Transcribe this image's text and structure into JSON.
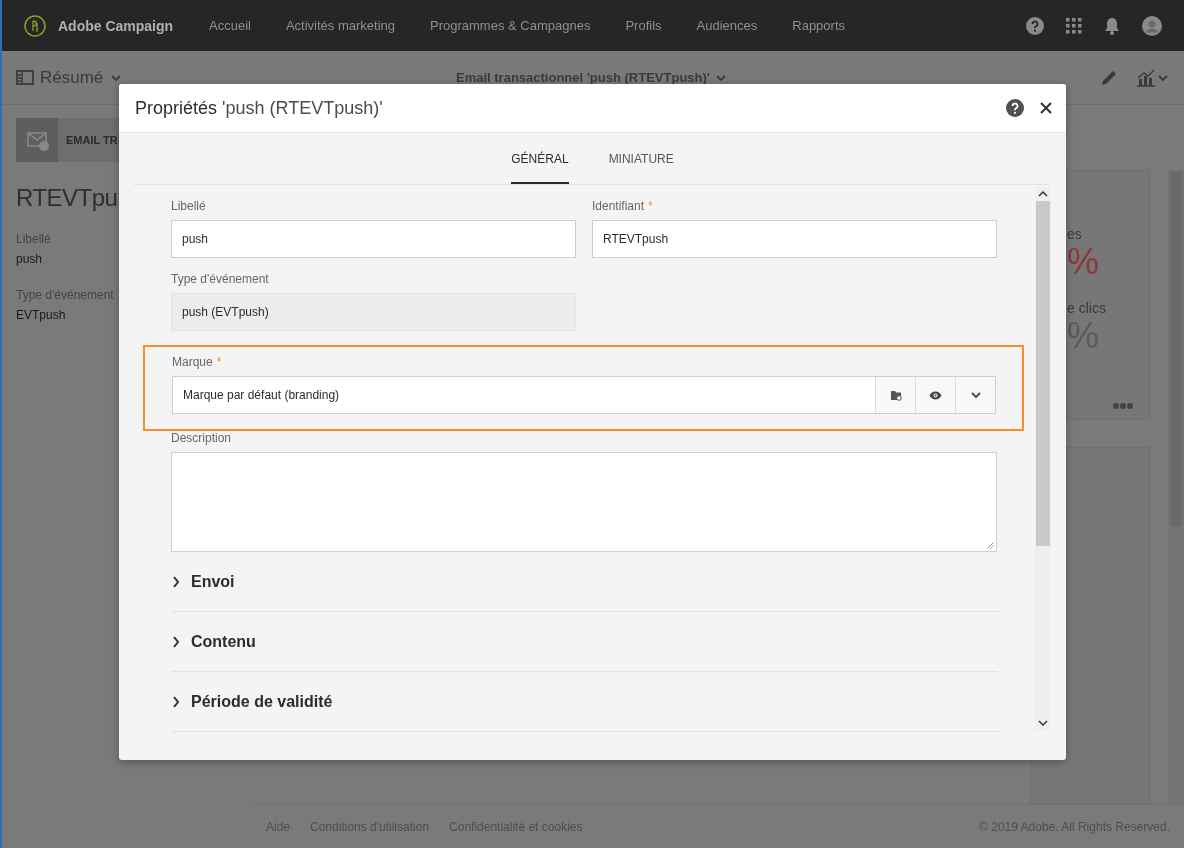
{
  "topbar": {
    "brand": "Adobe Campaign",
    "nav": [
      {
        "label": "Accueil"
      },
      {
        "label": "Activités marketing"
      },
      {
        "label": "Programmes & Campagnes"
      },
      {
        "label": "Profils"
      },
      {
        "label": "Audiences"
      },
      {
        "label": "Rapports"
      }
    ]
  },
  "subheader": {
    "view": "Résumé",
    "title": "Email transactionnel 'push (RTEVTpush)'"
  },
  "summary": {
    "badge": "EMAIL TR",
    "name": "RTEVTpu",
    "fields": [
      {
        "label": "Libellé",
        "value": "push"
      },
      {
        "label": "Type d'événement",
        "value": "EVTpush"
      }
    ]
  },
  "stats": [
    {
      "label": "es",
      "value": "%",
      "kind": "alert"
    },
    {
      "label": "e clics",
      "value": "%",
      "kind": "normal"
    }
  ],
  "footer": {
    "links": [
      "Aide",
      "Conditions d'utilisation",
      "Confidentialité et cookies"
    ],
    "copyright": "© 2019 Adobe. All Rights Reserved."
  },
  "dialog": {
    "title_prefix": "Propriétés",
    "title": "'push (RTEVTpush)'",
    "tabs": [
      {
        "label": "GÉNÉRAL",
        "selected": true
      },
      {
        "label": "MINIATURE",
        "selected": false
      }
    ],
    "fields": [
      {
        "kind": "text",
        "label": "Libellé",
        "value": "push"
      },
      {
        "kind": "text",
        "label": "Identifiant",
        "marker": "*",
        "value": "RTEVTpush"
      },
      {
        "kind": "readonly",
        "label": "Type d'événement",
        "value": "push (EVTpush)"
      },
      {
        "kind": "link",
        "label": "Marque",
        "marker": "*",
        "value": "Marque par défaut (branding)",
        "highlighted": true
      },
      {
        "kind": "textarea",
        "label": "Description"
      }
    ],
    "sections": [
      {
        "label": "Envoi",
        "expanded": false
      },
      {
        "label": "Contenu",
        "expanded": false
      },
      {
        "label": "Période de validité",
        "expanded": false
      }
    ]
  }
}
